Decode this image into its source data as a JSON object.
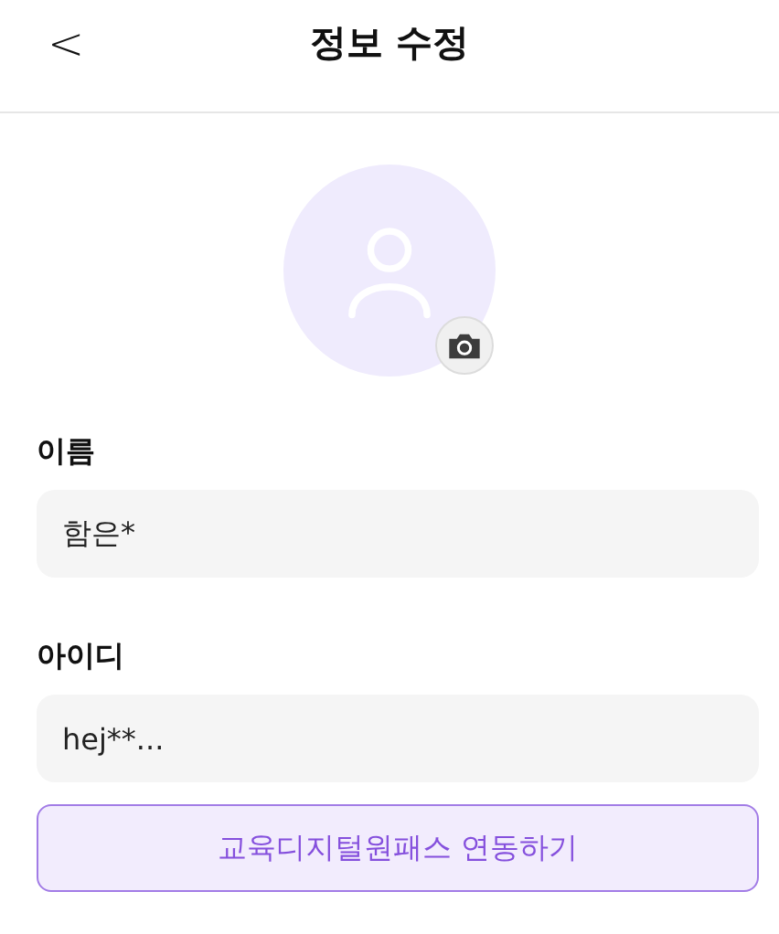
{
  "header": {
    "back": "<",
    "title": "정보 수정"
  },
  "fields": [
    {
      "label": "이름",
      "value": "함은*"
    },
    {
      "label": "아이디",
      "value": "hej**..."
    }
  ],
  "link_button": "교육디지털원패스 연동하기"
}
